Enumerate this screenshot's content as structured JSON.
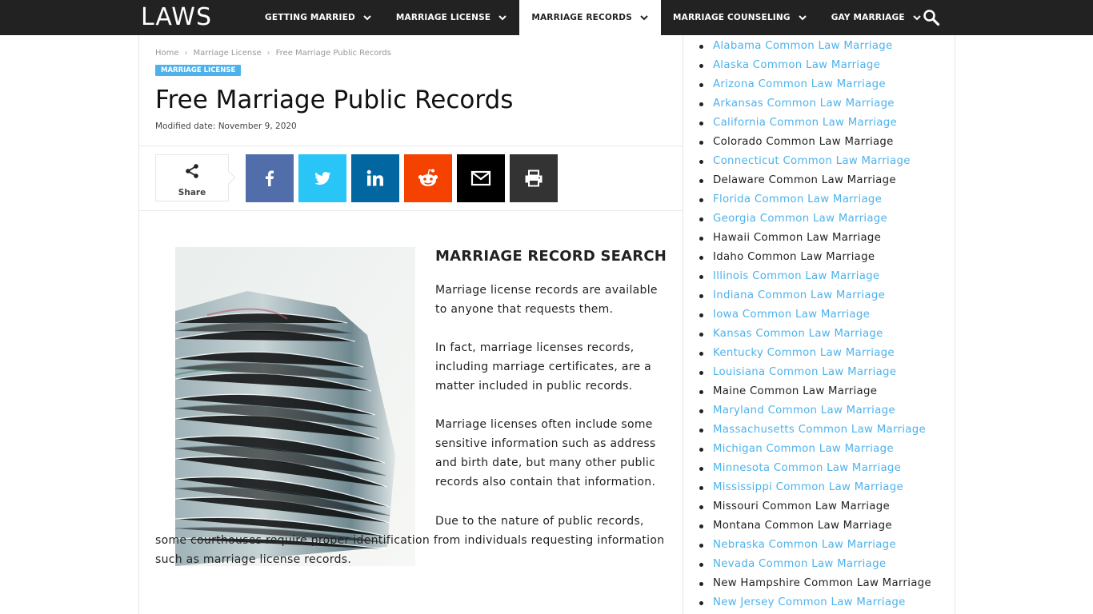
{
  "header": {
    "logo": "LAWS",
    "nav": [
      {
        "label": "GETTING MARRIED",
        "active": false
      },
      {
        "label": "MARRIAGE LICENSE",
        "active": false
      },
      {
        "label": "MARRIAGE RECORDS",
        "active": true
      },
      {
        "label": "MARRIAGE COUNSELING",
        "active": false
      },
      {
        "label": "GAY MARRIAGE",
        "active": false
      }
    ],
    "search_icon": "search-icon"
  },
  "breadcrumb": [
    "Home",
    "Marriage License",
    "Free Marriage Public Records"
  ],
  "category": "MARRIAGE LICENSE",
  "article": {
    "title": "Free Marriage Public Records",
    "modified": "Modified date: November 9, 2020",
    "heading": "MARRIAGE RECORD SEARCH",
    "paragraphs": [
      "Marriage license records are available to anyone that requests them.",
      "In fact, marriage licenses records, including marriage certificates, are a matter included in public records.",
      "Marriage licenses often include some sensitive information such as address and birth date, but many other public records also contain that information.",
      "Due to the nature of public records, some courthouses require proper identification from individuals requesting information such as marriage license records."
    ]
  },
  "share": {
    "label": "Share",
    "buttons": [
      {
        "name": "facebook",
        "icon": "facebook-icon",
        "color": "#516eab"
      },
      {
        "name": "twitter",
        "icon": "twitter-icon",
        "color": "#29c5f6"
      },
      {
        "name": "linkedin",
        "icon": "linkedin-icon",
        "color": "#0266a0"
      },
      {
        "name": "reddit",
        "icon": "reddit-icon",
        "color": "#f54200"
      },
      {
        "name": "email",
        "icon": "email-icon",
        "color": "#000000"
      },
      {
        "name": "print",
        "icon": "print-icon",
        "color": "#333333"
      }
    ]
  },
  "colors": {
    "accent": "#4db2ec",
    "topbar": "#222222"
  },
  "sidebar": {
    "states": [
      {
        "label": "Alabama Common Law Marriage",
        "link": true
      },
      {
        "label": "Alaska Common Law Marriage",
        "link": true
      },
      {
        "label": "Arizona Common Law Marriage",
        "link": true
      },
      {
        "label": "Arkansas Common Law Marriage",
        "link": true
      },
      {
        "label": "California Common Law Marriage",
        "link": true
      },
      {
        "label": "Colorado Common Law Marriage",
        "link": false
      },
      {
        "label": "Connecticut Common Law Marriage",
        "link": true
      },
      {
        "label": "Delaware Common Law Marriage",
        "link": false
      },
      {
        "label": "Florida Common Law Marriage",
        "link": true
      },
      {
        "label": "Georgia Common Law Marriage",
        "link": true
      },
      {
        "label": "Hawaii Common Law Marriage",
        "link": false
      },
      {
        "label": "Idaho Common Law Marriage",
        "link": false
      },
      {
        "label": "Illinois Common Law Marriage",
        "link": true
      },
      {
        "label": "Indiana Common Law Marriage",
        "link": true
      },
      {
        "label": "Iowa Common Law Marriage",
        "link": true
      },
      {
        "label": "Kansas Common Law Marriage",
        "link": true
      },
      {
        "label": "Kentucky Common Law Marriage",
        "link": true
      },
      {
        "label": "Louisiana Common Law Marriage",
        "link": true
      },
      {
        "label": "Maine Common Law Marriage",
        "link": false
      },
      {
        "label": "Maryland Common Law Marriage",
        "link": true
      },
      {
        "label": "Massachusetts Common Law Marriage",
        "link": true
      },
      {
        "label": "Michigan Common Law Marriage",
        "link": true
      },
      {
        "label": "Minnesota Common Law Marriage",
        "link": true
      },
      {
        "label": "Mississippi Common Law Marriage",
        "link": true
      },
      {
        "label": "Missouri Common Law Marriage",
        "link": false
      },
      {
        "label": "Montana Common Law Marriage",
        "link": false
      },
      {
        "label": "Nebraska Common Law Marriage",
        "link": true
      },
      {
        "label": "Nevada Common Law Marriage",
        "link": true
      },
      {
        "label": "New Hampshire Common Law Marriage",
        "link": false
      },
      {
        "label": "New Jersey Common Law Marriage",
        "link": true
      }
    ]
  }
}
